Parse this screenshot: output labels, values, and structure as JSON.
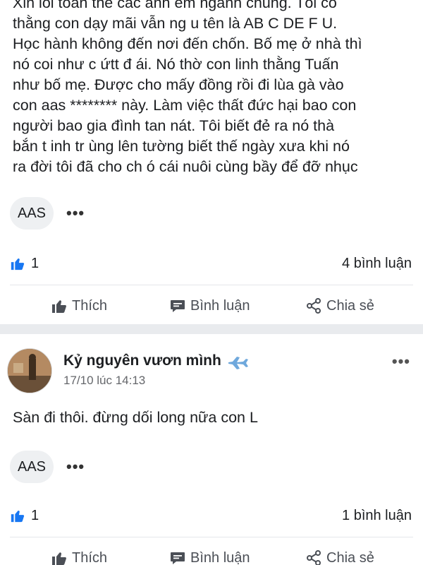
{
  "post1": {
    "body_lines": [
      "Xin lỗi toàn thể các anh em ngành chúng. Tôi có",
      "thằng con dạy mãi vẫn ng u tên là AB C DE F U.",
      "Học hành không đến nơi đến chốn. Bố mẹ ở nhà thì",
      "nó coi như c ứtt đ ái. Nó thờ con linh thằng Tuấn",
      "như bố mẹ. Được cho mấy đồng rồi đi lùa gà vào",
      "con aas ******** này. Làm việc thất đức hại bao con",
      "người bao gia đình tan nát. Tôi biết đẻ ra nó thà",
      "bắn t inh tr ùng lên tường biết thế ngày xưa khi nó",
      "ra đời tôi đã cho ch ó cái nuôi cùng bầy để đỡ nhục"
    ],
    "tag": "AAS",
    "more": "•••",
    "like_count": "1",
    "comment_count": "4 bình luận"
  },
  "post2": {
    "author": "Kỷ nguyên vươn mình",
    "author_emoji": "✈️",
    "time": "17/10 lúc 14:13",
    "more": "•••",
    "body": "Sàn đi thôi. đừng dối long nữa con L",
    "tag": "AAS",
    "tag_more": "•••",
    "like_count": "1",
    "comment_count": "1 bình luận"
  },
  "actions": {
    "like": "Thích",
    "comment": "Bình luận",
    "share": "Chia sẻ"
  },
  "icons": {
    "like": "thumbs-up-icon",
    "comment": "comment-bubble-icon",
    "share": "share-icon",
    "reaction": "like-reaction-icon"
  },
  "colors": {
    "like_blue": "#1877f2",
    "action_gray": "#4b4f56",
    "separator": "#e9ebee"
  }
}
